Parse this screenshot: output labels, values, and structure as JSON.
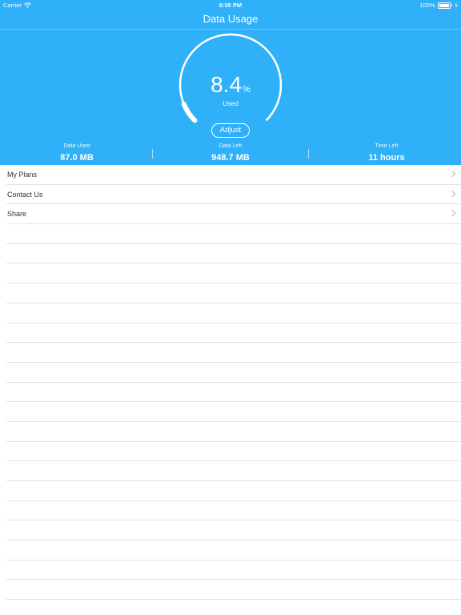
{
  "status_bar": {
    "carrier": "Carrier",
    "time": "6:05 PM",
    "battery_percent": "100%",
    "battery_level": 1.0
  },
  "header": {
    "title": "Data Usage"
  },
  "gauge": {
    "value": "8.4",
    "unit": "%",
    "label": "Used",
    "fraction_used": 0.084
  },
  "adjust_label": "Adjust",
  "stats": [
    {
      "label": "Data Used",
      "value": "87.0 MB"
    },
    {
      "label": "Data Left",
      "value": "948.7 MB"
    },
    {
      "label": "Time Left",
      "value": "11 hours"
    }
  ],
  "menu": [
    {
      "label": "My Plans"
    },
    {
      "label": "Contact Us"
    },
    {
      "label": "Share"
    }
  ],
  "colors": {
    "accent": "#30b0f8",
    "text": "#333333",
    "separator": "#e2e2e2"
  }
}
